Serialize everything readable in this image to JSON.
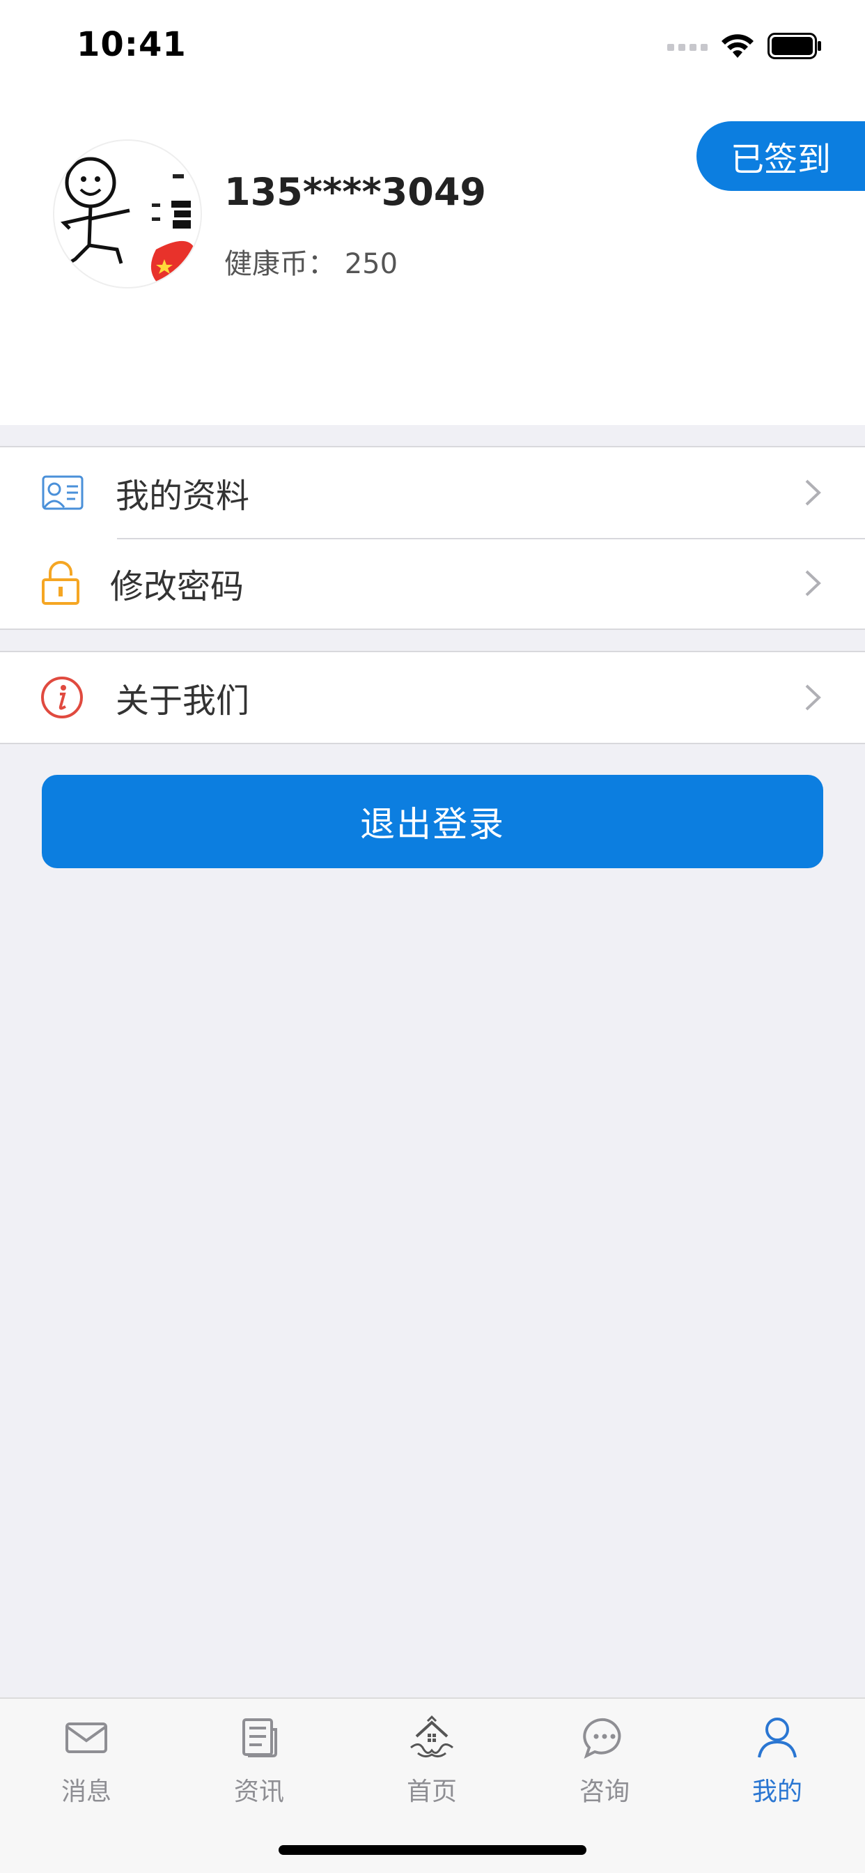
{
  "status_bar": {
    "time": "10:41"
  },
  "header": {
    "username": "135****3049",
    "coins_text": "健康币： 250",
    "checkin_label": "已签到"
  },
  "menu": {
    "group1": [
      {
        "label": "我的资料",
        "icon": "profile-card-icon"
      },
      {
        "label": "修改密码",
        "icon": "unlock-icon"
      }
    ],
    "group2": [
      {
        "label": "关于我们",
        "icon": "info-icon"
      }
    ]
  },
  "logout_label": "退出登录",
  "tabs": [
    {
      "label": "消息",
      "icon": "mail-icon"
    },
    {
      "label": "资讯",
      "icon": "news-icon"
    },
    {
      "label": "首页",
      "icon": "home-icon"
    },
    {
      "label": "咨询",
      "icon": "chat-icon"
    },
    {
      "label": "我的",
      "icon": "user-icon",
      "active": true
    }
  ],
  "colors": {
    "primary": "#0c7ee0",
    "active_tab": "#2a76d2",
    "profile_icon": "#4a90d9",
    "lock_icon": "#f5a623",
    "info_icon": "#e04a3f"
  }
}
